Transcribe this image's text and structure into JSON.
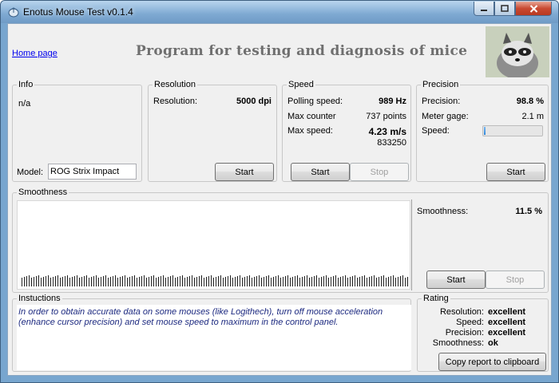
{
  "window": {
    "title": "Enotus Mouse Test v0.1.4",
    "icon": "mouse-app-icon",
    "controls": [
      "minimize",
      "maximize",
      "close"
    ]
  },
  "header": {
    "home_link": "Home page",
    "headline": "Program for testing and diagnosis of mice",
    "logo": "raccoon-photo"
  },
  "info": {
    "title": "Info",
    "text": "n/a",
    "model_label": "Model:",
    "model_value": "ROG Strix Impact"
  },
  "resolution": {
    "title": "Resolution",
    "label": "Resolution:",
    "value": "5000 dpi",
    "start": "Start"
  },
  "speed": {
    "title": "Speed",
    "polling_label": "Polling speed:",
    "polling_value": "989 Hz",
    "counter_label": "Max counter",
    "counter_value": "737 points",
    "maxspeed_label": "Max  speed:",
    "maxspeed_value": "4.23 m/s",
    "maxspeed_sub": "833250",
    "start": "Start",
    "stop": "Stop"
  },
  "precision": {
    "title": "Precision",
    "precision_label": "Precision:",
    "precision_value": "98.8 %",
    "gage_label": "Meter gage:",
    "gage_value": "2.1 m",
    "speed_label": "Speed:",
    "speed_fraction": 0.03,
    "start": "Start"
  },
  "smoothness": {
    "title": "Smoothness",
    "label": "Smoothness:",
    "value": "11.5 %",
    "start": "Start",
    "stop": "Stop"
  },
  "instructions": {
    "title": "Instuctions",
    "text": "In order to obtain accurate data on some mouses (like Logithech), turn off mouse acceleration (enhance cursor precision) and set mouse speed to maximum in the control panel."
  },
  "rating": {
    "title": "Rating",
    "rows": [
      {
        "label": "Resolution:",
        "value": "excellent"
      },
      {
        "label": "Speed:",
        "value": "excellent"
      },
      {
        "label": "Precision:",
        "value": "excellent"
      },
      {
        "label": "Smoothness:",
        "value": "ok"
      }
    ],
    "copy_button": "Copy report to clipboard"
  }
}
